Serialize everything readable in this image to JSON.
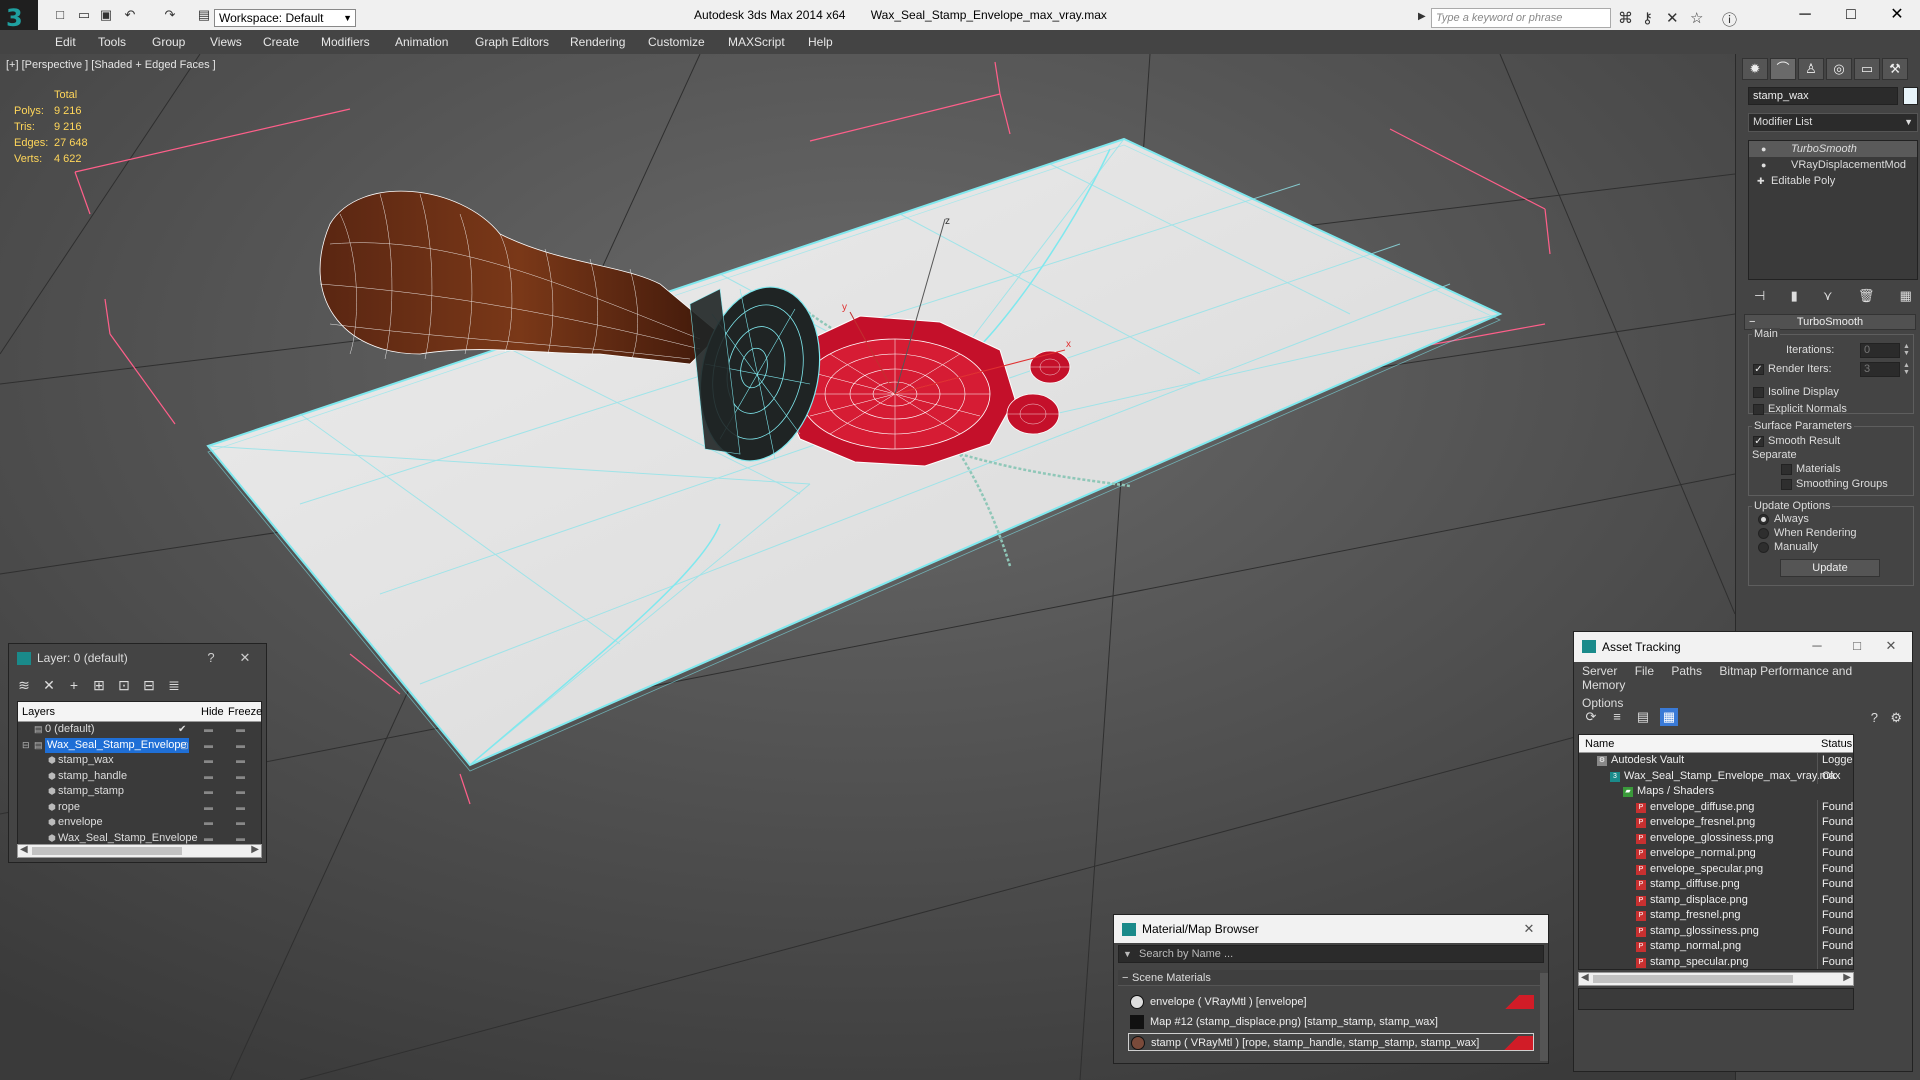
{
  "titlebar": {
    "workspace_label": "Workspace: Default",
    "app_name": "Autodesk 3ds Max  2014 x64",
    "file_name": "Wax_Seal_Stamp_Envelope_max_vray.max",
    "search_placeholder": "Type a keyword or phrase"
  },
  "menu": [
    "Edit",
    "Tools",
    "Group",
    "Views",
    "Create",
    "Modifiers",
    "Animation",
    "Graph Editors",
    "Rendering",
    "Customize",
    "MAXScript",
    "Help"
  ],
  "viewport": {
    "label": "[+] [Perspective ] [Shaded + Edged Faces ]",
    "stats": {
      "header": "Total",
      "rows": [
        {
          "k": "Polys:",
          "v": "9 216"
        },
        {
          "k": "Tris:",
          "v": "9 216"
        },
        {
          "k": "Edges:",
          "v": "27 648"
        },
        {
          "k": "Verts:",
          "v": "4 622"
        }
      ]
    },
    "gizmo": {
      "x": "x",
      "y": "y",
      "z": "z"
    }
  },
  "command_panel": {
    "object_name": "stamp_wax",
    "modifier_list": "Modifier List",
    "stack": [
      "TurboSmooth",
      "VRayDisplacementMod",
      "Editable Poly"
    ],
    "rollout_title": "TurboSmooth",
    "main_label": "Main",
    "iterations_label": "Iterations:",
    "iterations_value": "0",
    "render_iters_label": "Render Iters:",
    "render_iters_value": "3",
    "isoline_label": "Isoline Display",
    "explicit_normals_label": "Explicit Normals",
    "surface_params_label": "Surface Parameters",
    "smooth_result_label": "Smooth Result",
    "separate_label": "Separate",
    "materials_label": "Materials",
    "smoothing_groups_label": "Smoothing Groups",
    "update_options_label": "Update Options",
    "always_label": "Always",
    "when_rendering_label": "When Rendering",
    "manually_label": "Manually",
    "update_button": "Update"
  },
  "layer_explorer": {
    "title": "Layer: 0 (default)",
    "help": "?",
    "columns": {
      "layers": "Layers",
      "hide": "Hide",
      "freeze": "Freeze"
    },
    "rows": [
      {
        "name": "0 (default)",
        "indent": 0,
        "checked": true
      },
      {
        "name": "Wax_Seal_Stamp_Envelope",
        "indent": 0,
        "selected": true
      },
      {
        "name": "stamp_wax",
        "indent": 1
      },
      {
        "name": "stamp_handle",
        "indent": 1
      },
      {
        "name": "stamp_stamp",
        "indent": 1
      },
      {
        "name": "rope",
        "indent": 1
      },
      {
        "name": "envelope",
        "indent": 1
      },
      {
        "name": "Wax_Seal_Stamp_Envelope",
        "indent": 1
      }
    ]
  },
  "material_browser": {
    "title": "Material/Map Browser",
    "search_placeholder": "Search by Name ...",
    "section": "Scene Materials",
    "rows": [
      {
        "label": "envelope  ( VRayMtl )  [envelope]",
        "swatch": "#e8e8e8",
        "tag": true
      },
      {
        "label": "Map #12 (stamp_displace.png)  [stamp_stamp, stamp_wax]",
        "swatch": "#111111",
        "tag": false
      },
      {
        "label": "stamp  ( VRayMtl )  [rope, stamp_handle, stamp_stamp, stamp_wax]",
        "swatch": "#7a4a3a",
        "tag": true,
        "selected": true
      }
    ]
  },
  "asset_tracking": {
    "title": "Asset Tracking",
    "menu": [
      "Server",
      "File",
      "Paths",
      "Bitmap Performance and Memory"
    ],
    "options": "Options",
    "columns": {
      "name": "Name",
      "status": "Status"
    },
    "rows": [
      {
        "name": "Autodesk Vault",
        "status": "Logged O",
        "indent": 0,
        "icon": "vault"
      },
      {
        "name": "Wax_Seal_Stamp_Envelope_max_vray.max",
        "status": "Ok",
        "indent": 1,
        "icon": "max"
      },
      {
        "name": "Maps / Shaders",
        "status": "",
        "indent": 2,
        "icon": "maps"
      },
      {
        "name": "envelope_diffuse.png",
        "status": "Found",
        "indent": 3,
        "icon": "png"
      },
      {
        "name": "envelope_fresnel.png",
        "status": "Found",
        "indent": 3,
        "icon": "png"
      },
      {
        "name": "envelope_glossiness.png",
        "status": "Found",
        "indent": 3,
        "icon": "png"
      },
      {
        "name": "envelope_normal.png",
        "status": "Found",
        "indent": 3,
        "icon": "png"
      },
      {
        "name": "envelope_specular.png",
        "status": "Found",
        "indent": 3,
        "icon": "png"
      },
      {
        "name": "stamp_diffuse.png",
        "status": "Found",
        "indent": 3,
        "icon": "png"
      },
      {
        "name": "stamp_displace.png",
        "status": "Found",
        "indent": 3,
        "icon": "png"
      },
      {
        "name": "stamp_fresnel.png",
        "status": "Found",
        "indent": 3,
        "icon": "png"
      },
      {
        "name": "stamp_glossiness.png",
        "status": "Found",
        "indent": 3,
        "icon": "png"
      },
      {
        "name": "stamp_normal.png",
        "status": "Found",
        "indent": 3,
        "icon": "png"
      },
      {
        "name": "stamp_specular.png",
        "status": "Found",
        "indent": 3,
        "icon": "png"
      }
    ]
  }
}
